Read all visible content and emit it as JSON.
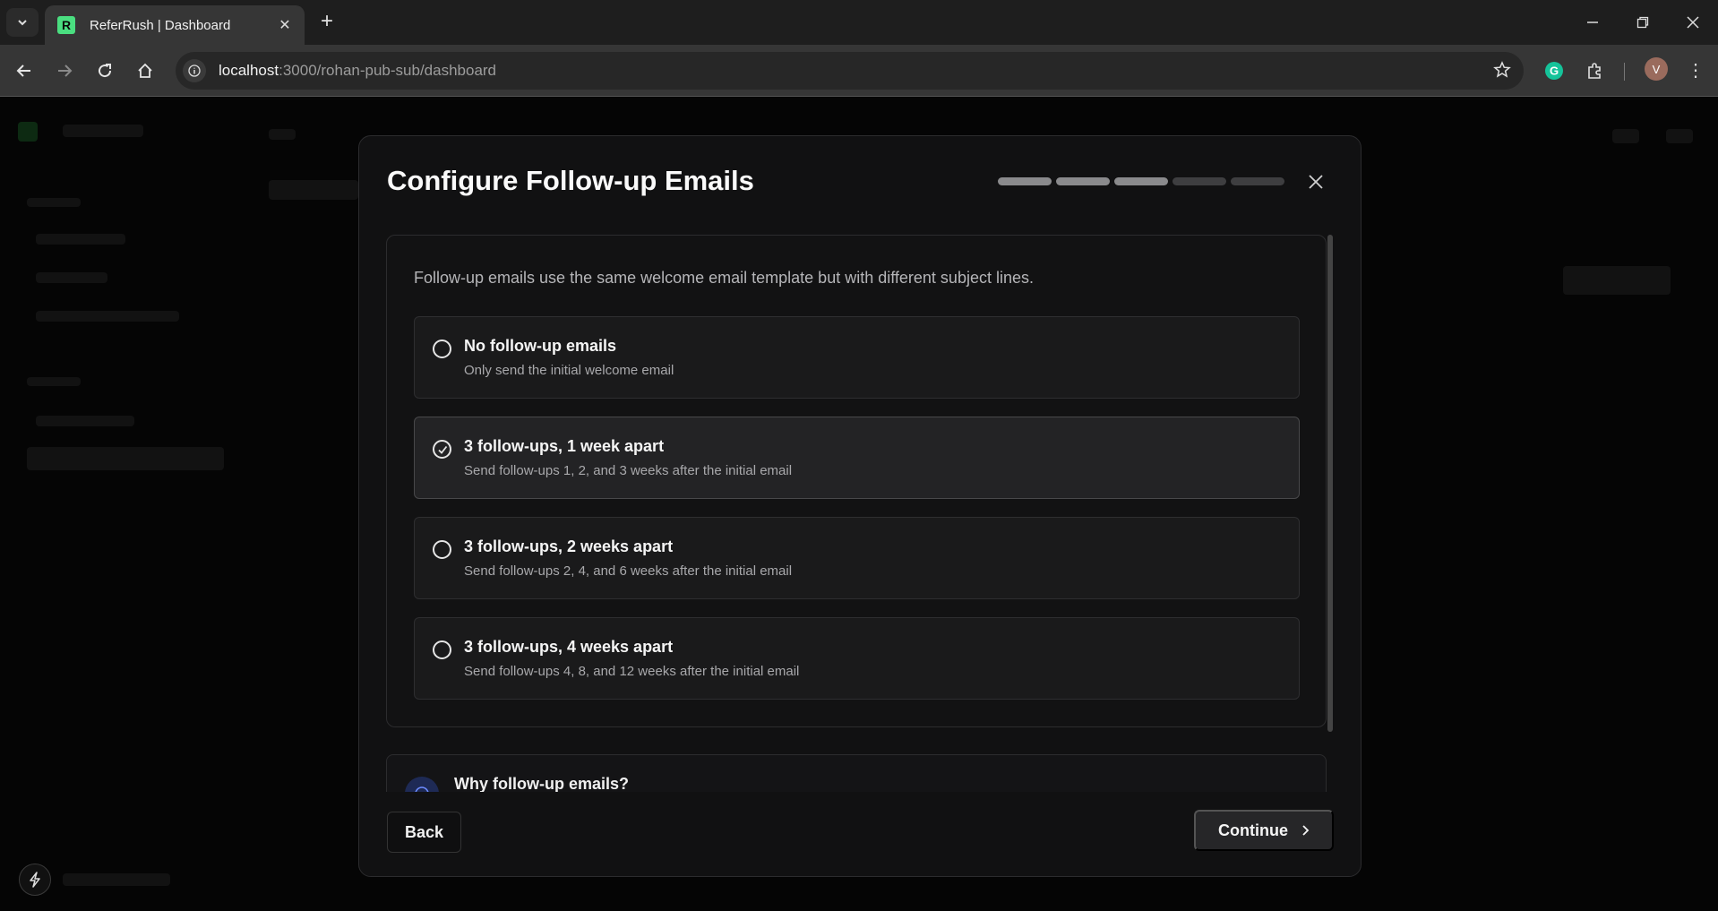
{
  "browser": {
    "tab_title": "ReferRush | Dashboard",
    "favicon_letter": "R",
    "url_host": "localhost",
    "url_path": ":3000/rohan-pub-sub/dashboard",
    "avatar_initial": "V"
  },
  "modal": {
    "title": "Configure Follow-up Emails",
    "progress": {
      "total_steps": 5,
      "completed_steps": 3
    },
    "intro": "Follow-up emails use the same welcome email template but with different subject lines.",
    "options": [
      {
        "title": "No follow-up emails",
        "description": "Only send the initial welcome email",
        "selected": false
      },
      {
        "title": "3 follow-ups, 1 week apart",
        "description": "Send follow-ups 1, 2, and 3 weeks after the initial email",
        "selected": true
      },
      {
        "title": "3 follow-ups, 2 weeks apart",
        "description": "Send follow-ups 2, 4, and 6 weeks after the initial email",
        "selected": false
      },
      {
        "title": "3 follow-ups, 4 weeks apart",
        "description": "Send follow-ups 4, 8, and 12 weeks after the initial email",
        "selected": false
      }
    ],
    "info": {
      "title": "Why follow-up emails?"
    },
    "back_label": "Back",
    "continue_label": "Continue"
  }
}
